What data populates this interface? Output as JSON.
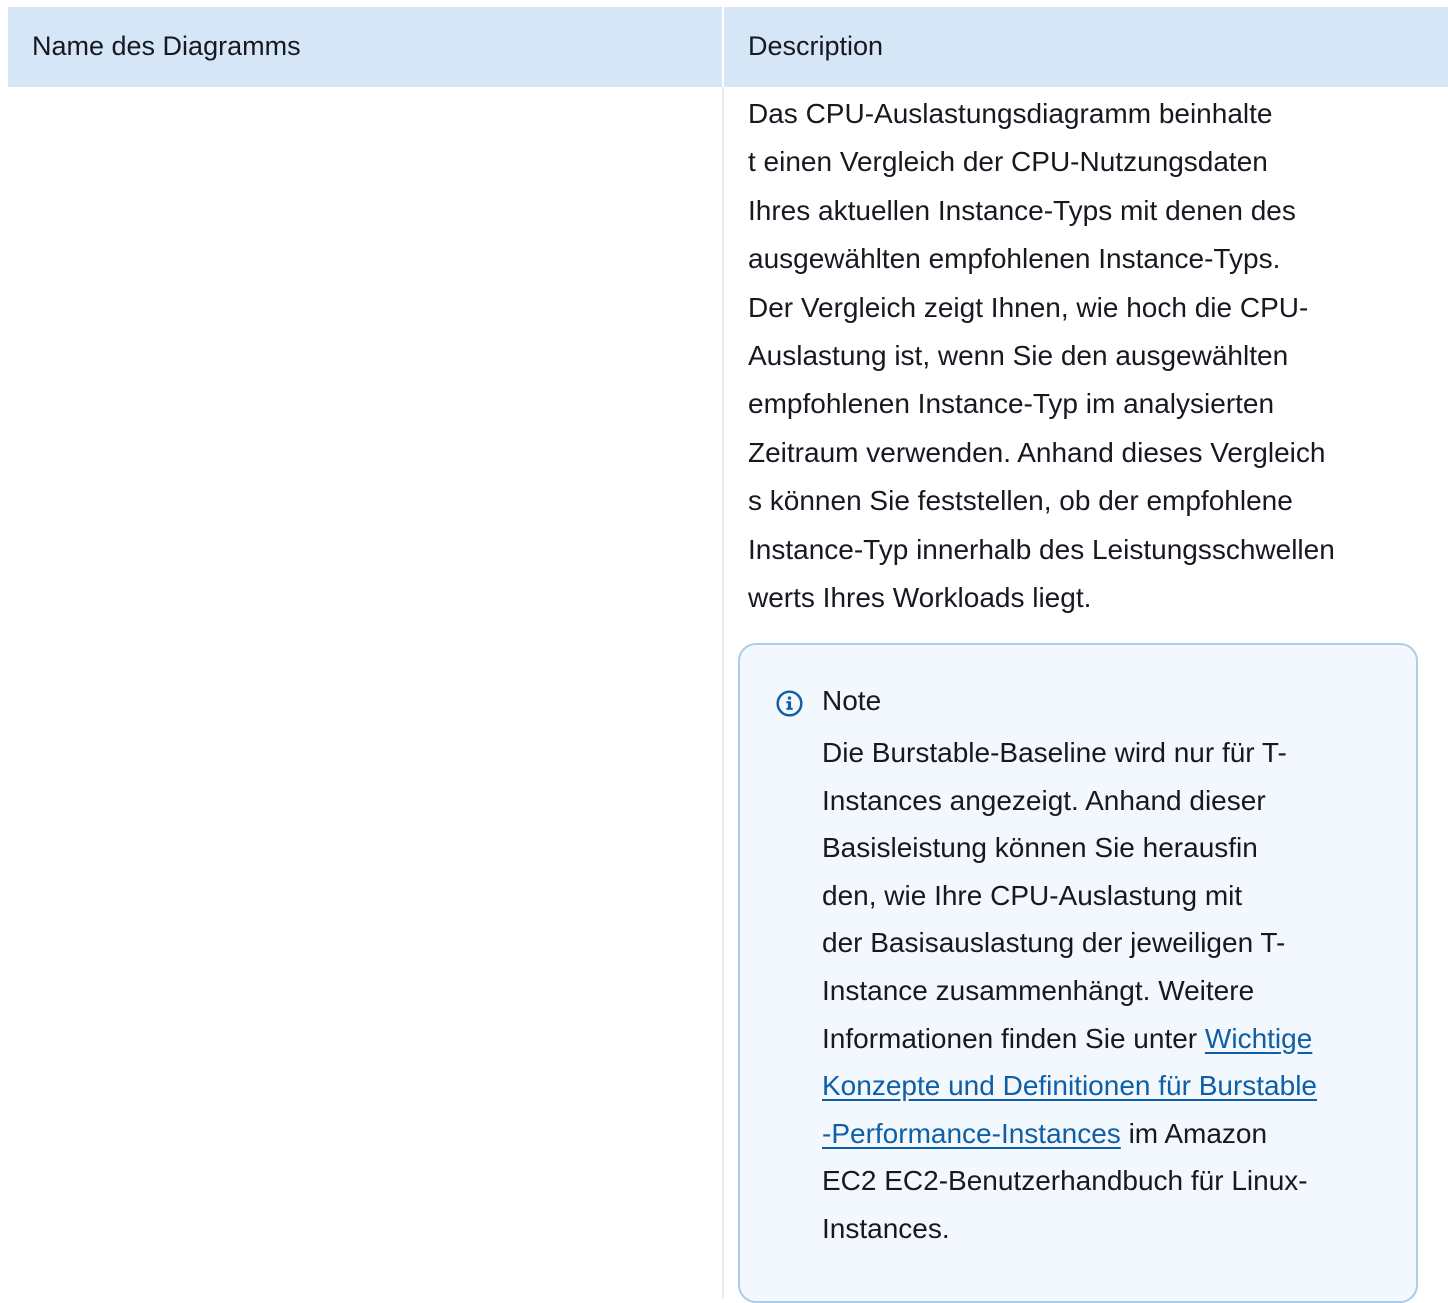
{
  "table": {
    "headers": {
      "name": "Name des Diagramms",
      "description": "Description"
    },
    "row": {
      "name": "",
      "description_lines": [
        "Das CPU-Auslastungsdiagramm beinhalte",
        "t einen Vergleich der CPU-Nutzungsdaten",
        "Ihres aktuellen Instance-Typs mit denen des",
        "ausgewählten empfohlenen Instance-Typs.",
        "Der Vergleich zeigt Ihnen, wie hoch die CPU-",
        "Auslastung ist, wenn Sie den ausgewählten",
        "empfohlenen Instance-Typ im analysierten",
        "Zeitraum verwenden. Anhand dieses Vergleich",
        "s können Sie feststellen, ob der empfohlene",
        "Instance-Typ innerhalb des Leistungsschwellen",
        "werts Ihres Workloads liegt."
      ]
    }
  },
  "note": {
    "icon": "info-icon",
    "title": "Note",
    "lines": [
      "Die Burstable-Baseline wird nur für T-",
      "Instances angezeigt. Anhand dieser",
      "Basisleistung können Sie herausfin",
      "den, wie Ihre CPU-Auslastung mit",
      "der Basisauslastung der jeweiligen T-",
      "Instance zusammenhängt. Weitere"
    ],
    "line7_prefix": "Informationen finden Sie unter ",
    "link_parts": [
      "Wichtige",
      "Konzepte und Definitionen für Burstable",
      "-Performance-Instances"
    ],
    "line9_suffix": " im Amazon",
    "tail_lines": [
      "EC2 EC2-Benutzerhandbuch für Linux-",
      "Instances."
    ]
  },
  "colors": {
    "header_bg": "#d5e6f7",
    "note_border": "#a9cdec",
    "note_bg": "#f2f8fd",
    "link": "#0f5fa8",
    "icon": "#0f5fa8"
  }
}
